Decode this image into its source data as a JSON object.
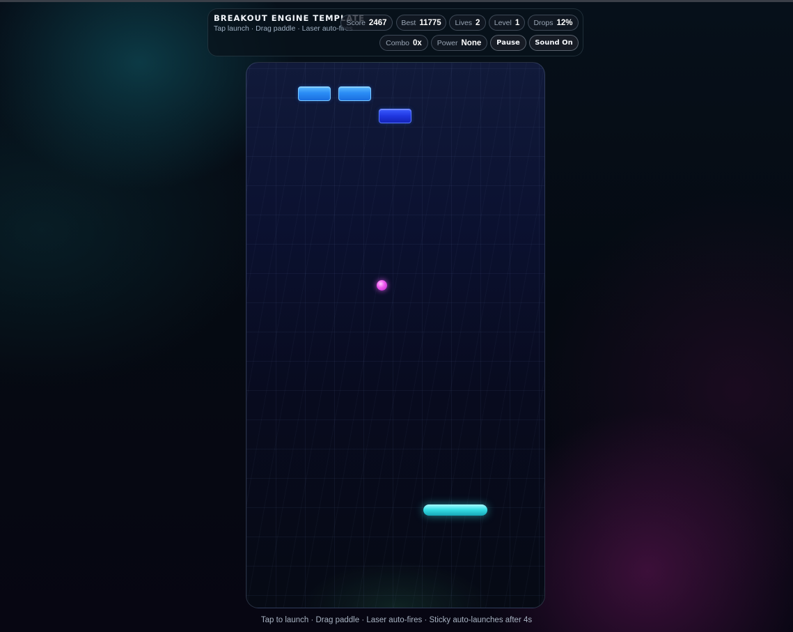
{
  "hud": {
    "title": "BREAKOUT ENGINE TEMPLATE",
    "subtitle": "Tap launch · Drag paddle · Laser auto-fires",
    "stats": {
      "score": {
        "label": "Score",
        "value": "2467"
      },
      "best": {
        "label": "Best",
        "value": "11775"
      },
      "lives": {
        "label": "Lives",
        "value": "2"
      },
      "level": {
        "label": "Level",
        "value": "1"
      },
      "drops": {
        "label": "Drops",
        "value": "12%"
      },
      "combo": {
        "label": "Combo",
        "value": "0x"
      },
      "power": {
        "label": "Power",
        "value": "None"
      }
    },
    "buttons": {
      "pause": "Pause",
      "sound": "Sound On"
    }
  },
  "game": {
    "bricks": [
      {
        "style": "light",
        "color": "#2a8cf5"
      },
      {
        "style": "light",
        "color": "#2a8cf5"
      },
      {
        "style": "dark",
        "color": "#1f36e0"
      }
    ],
    "ball_color": "#ef5cf0",
    "paddle_color": "#37dfe6"
  },
  "footer": {
    "hint": "Tap to launch · Drag paddle · Laser auto-fires · Sticky auto-launches after 4s"
  }
}
